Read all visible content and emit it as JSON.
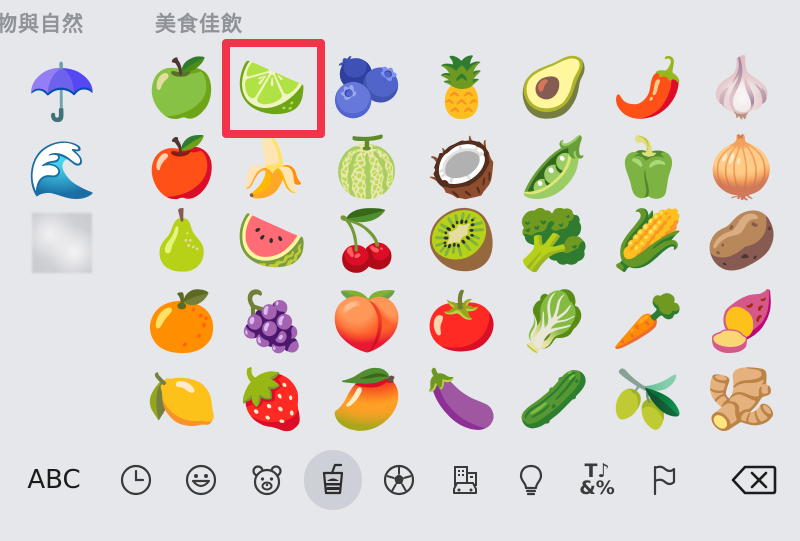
{
  "sections": {
    "previous_title": "物與自然",
    "food_title": "美食佳飲"
  },
  "previous_section": [
    {
      "name": "umbrella",
      "char": "☂️"
    },
    {
      "name": "water-wave",
      "char": "🌊"
    },
    {
      "name": "fog",
      "char": ""
    }
  ],
  "food_grid": {
    "rows": [
      [
        {
          "name": "green-apple",
          "char": "🍏"
        },
        {
          "name": "lime",
          "char": "🍋‍🟩"
        },
        {
          "name": "blueberries",
          "char": "🫐"
        },
        {
          "name": "pineapple",
          "char": "🍍"
        },
        {
          "name": "avocado",
          "char": "🥑"
        },
        {
          "name": "hot-pepper",
          "char": "🌶️"
        },
        {
          "name": "garlic",
          "char": "🧄"
        }
      ],
      [
        {
          "name": "red-apple",
          "char": "🍎"
        },
        {
          "name": "banana",
          "char": "🍌"
        },
        {
          "name": "melon",
          "char": "🍈"
        },
        {
          "name": "coconut",
          "char": "🥥"
        },
        {
          "name": "pea-pod",
          "char": "🫛"
        },
        {
          "name": "bell-pepper",
          "char": "🫑"
        },
        {
          "name": "onion",
          "char": "🧅"
        }
      ],
      [
        {
          "name": "pear",
          "char": "🍐"
        },
        {
          "name": "watermelon",
          "char": "🍉"
        },
        {
          "name": "cherries",
          "char": "🍒"
        },
        {
          "name": "kiwi",
          "char": "🥝"
        },
        {
          "name": "broccoli",
          "char": "🥦"
        },
        {
          "name": "corn",
          "char": "🌽"
        },
        {
          "name": "potato",
          "char": "🥔"
        }
      ],
      [
        {
          "name": "tangerine",
          "char": "🍊"
        },
        {
          "name": "grapes",
          "char": "🍇"
        },
        {
          "name": "peach",
          "char": "🍑"
        },
        {
          "name": "tomato",
          "char": "🍅"
        },
        {
          "name": "leafy-green",
          "char": "🥬"
        },
        {
          "name": "carrot",
          "char": "🥕"
        },
        {
          "name": "sweet-potato",
          "char": "🍠"
        }
      ],
      [
        {
          "name": "lemon",
          "char": "🍋"
        },
        {
          "name": "strawberry",
          "char": "🍓"
        },
        {
          "name": "mango",
          "char": "🥭"
        },
        {
          "name": "eggplant",
          "char": "🍆"
        },
        {
          "name": "cucumber",
          "char": "🥒"
        },
        {
          "name": "olive",
          "char": "🫒"
        },
        {
          "name": "ginger",
          "char": "🫚"
        }
      ]
    ],
    "highlighted": "lime"
  },
  "toolbar": {
    "abc_label": "ABC",
    "symbols_label_top": "T♪",
    "symbols_label_bottom": "&%",
    "active_category": "food-drink",
    "highlight_color": "#f0344a"
  }
}
